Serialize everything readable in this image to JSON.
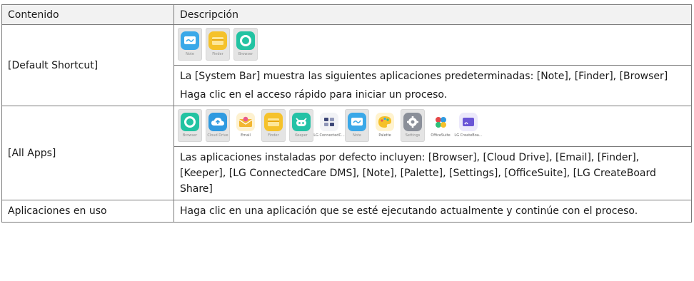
{
  "table": {
    "header": {
      "col1": "Contenido",
      "col2": "Descripción"
    },
    "rows": [
      {
        "label": "[Default Shortcut]",
        "apps": [
          {
            "name": "Note",
            "icon": "note-icon",
            "color": "#3aa8e8"
          },
          {
            "name": "Finder",
            "icon": "finder-icon",
            "color": "#f5c22b"
          },
          {
            "name": "Browser",
            "icon": "browser-icon",
            "color": "#22c3a2"
          }
        ],
        "paragraphs": [
          "La [System Bar] muestra las siguientes aplicaciones predeterminadas: [Note], [Finder], [Browser]",
          "Haga clic en el acceso rápido para iniciar un proceso."
        ]
      },
      {
        "label": "[All Apps]",
        "apps": [
          {
            "name": "Browser",
            "icon": "browser-icon",
            "color": "#22c3a2"
          },
          {
            "name": "Cloud Drive",
            "icon": "cloud-drive-icon",
            "color": "#2f9ae0"
          },
          {
            "name": "Email",
            "icon": "email-icon",
            "color": "#f2b632"
          },
          {
            "name": "Finder",
            "icon": "finder-icon",
            "color": "#f5c22b"
          },
          {
            "name": "Keeper",
            "icon": "keeper-icon",
            "color": "#24c2a6"
          },
          {
            "name": "LG ConnectedC...",
            "icon": "connectedcare-icon",
            "color": "#3c4676"
          },
          {
            "name": "Note",
            "icon": "note-icon",
            "color": "#3aa8e8"
          },
          {
            "name": "Palette",
            "icon": "palette-icon",
            "color": "#f5c02a"
          },
          {
            "name": "Settings",
            "icon": "settings-icon",
            "color": "#8a8f99"
          },
          {
            "name": "OfficeSuite",
            "icon": "officesuite-icon",
            "color": "#e54848"
          },
          {
            "name": "LG CreateBoa...",
            "icon": "createboard-icon",
            "color": "#6a55d6"
          }
        ],
        "paragraphs": [
          "Las aplicaciones instaladas por defecto incluyen: [Browser], [Cloud Drive], [Email], [Finder], [Keeper], [LG ConnectedCare DMS], [Note], [Palette], [Settings], [OfficeSuite], [LG CreateBoard Share]"
        ]
      },
      {
        "label": "Aplicaciones en uso",
        "paragraphs": [
          "Haga clic en una aplicación que se esté ejecutando actualmente y continúe con el proceso."
        ]
      }
    ]
  }
}
